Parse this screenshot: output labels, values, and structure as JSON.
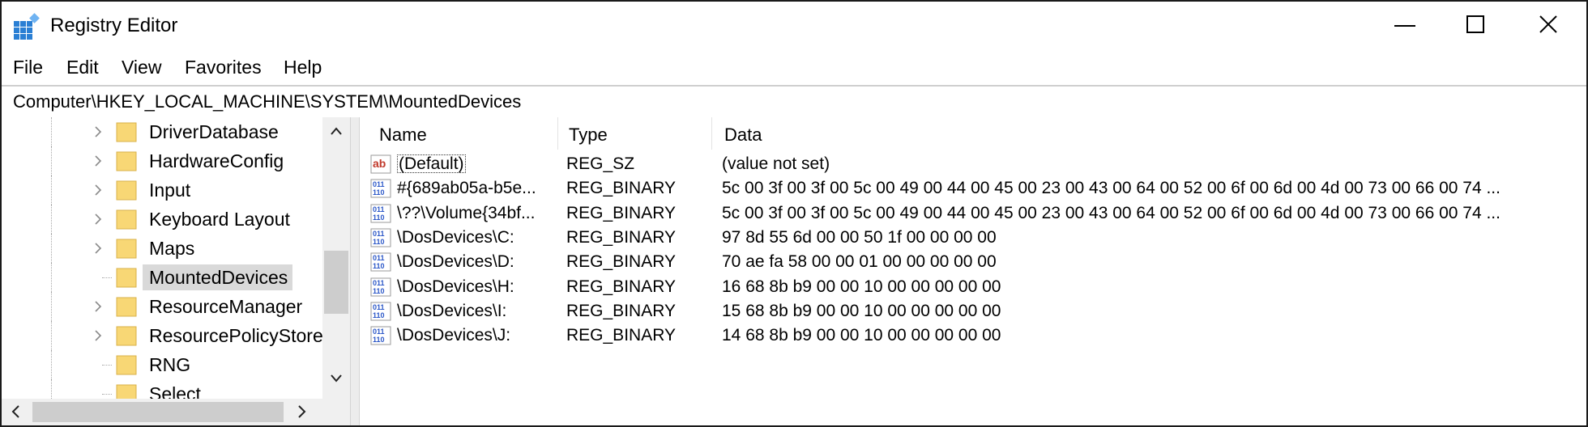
{
  "window": {
    "title": "Registry Editor",
    "controls": {
      "minimize": "minimize",
      "maximize": "maximize",
      "close": "close"
    }
  },
  "menu": [
    "File",
    "Edit",
    "View",
    "Favorites",
    "Help"
  ],
  "address": "Computer\\HKEY_LOCAL_MACHINE\\SYSTEM\\MountedDevices",
  "tree": {
    "items": [
      {
        "label": "DriverDatabase",
        "expandable": true
      },
      {
        "label": "HardwareConfig",
        "expandable": true
      },
      {
        "label": "Input",
        "expandable": true
      },
      {
        "label": "Keyboard Layout",
        "expandable": true
      },
      {
        "label": "Maps",
        "expandable": true
      },
      {
        "label": "MountedDevices",
        "expandable": false,
        "selected": true
      },
      {
        "label": "ResourceManager",
        "expandable": true
      },
      {
        "label": "ResourcePolicyStore",
        "expandable": true
      },
      {
        "label": "RNG",
        "expandable": false
      },
      {
        "label": "Select",
        "expandable": false
      }
    ]
  },
  "list": {
    "columns": {
      "name": "Name",
      "type": "Type",
      "data": "Data"
    },
    "rows": [
      {
        "icon": "string-value-icon",
        "name": "(Default)",
        "type": "REG_SZ",
        "data": "(value not set)"
      },
      {
        "icon": "binary-value-icon",
        "name": "#{689ab05a-b5e...",
        "type": "REG_BINARY",
        "data": "5c 00 3f 00 3f 00 5c 00 49 00 44 00 45 00 23 00 43 00 64 00 52 00 6f 00 6d 00 4d 00 73 00 66 00 74 ..."
      },
      {
        "icon": "binary-value-icon",
        "name": "\\??\\Volume{34bf...",
        "type": "REG_BINARY",
        "data": "5c 00 3f 00 3f 00 5c 00 49 00 44 00 45 00 23 00 43 00 64 00 52 00 6f 00 6d 00 4d 00 73 00 66 00 74 ..."
      },
      {
        "icon": "binary-value-icon",
        "name": "\\DosDevices\\C:",
        "type": "REG_BINARY",
        "data": "97 8d 55 6d 00 00 50 1f 00 00 00 00"
      },
      {
        "icon": "binary-value-icon",
        "name": "\\DosDevices\\D:",
        "type": "REG_BINARY",
        "data": "70 ae fa 58 00 00 01 00 00 00 00 00"
      },
      {
        "icon": "binary-value-icon",
        "name": "\\DosDevices\\H:",
        "type": "REG_BINARY",
        "data": "16 68 8b b9 00 00 10 00 00 00 00 00"
      },
      {
        "icon": "binary-value-icon",
        "name": "\\DosDevices\\I:",
        "type": "REG_BINARY",
        "data": "15 68 8b b9 00 00 10 00 00 00 00 00"
      },
      {
        "icon": "binary-value-icon",
        "name": "\\DosDevices\\J:",
        "type": "REG_BINARY",
        "data": "14 68 8b b9 00 00 10 00 00 00 00 00"
      }
    ]
  },
  "colors": {
    "selected_row": "#d9d9d9",
    "folder": "#f8d775",
    "string_icon": "#c0392b",
    "binary_icon": "#2b57c8"
  }
}
